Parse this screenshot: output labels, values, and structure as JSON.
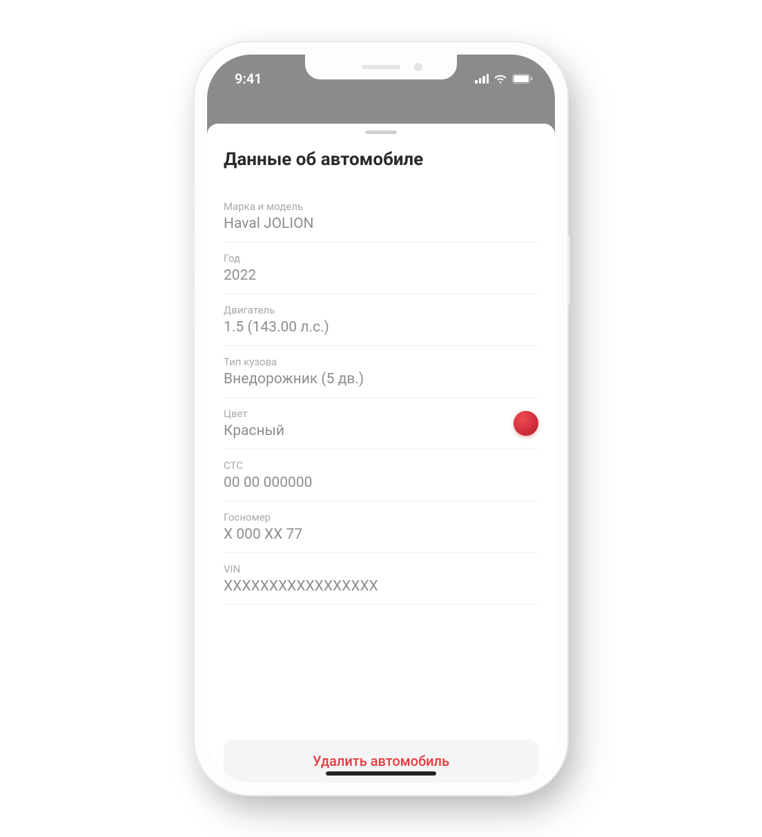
{
  "status": {
    "time": "9:41"
  },
  "page": {
    "title": "Данные об автомобиле"
  },
  "fields": {
    "make_model": {
      "label": "Марка и модель",
      "value": "Haval JOLION"
    },
    "year": {
      "label": "Год",
      "value": "2022"
    },
    "engine": {
      "label": "Двигатель",
      "value": "1.5 (143.00 л.с.)"
    },
    "body": {
      "label": "Тип кузова",
      "value": "Внедорожник (5 дв.)"
    },
    "color": {
      "label": "Цвет",
      "value": "Красный",
      "swatch": "#d7323a"
    },
    "sts": {
      "label": "СТС",
      "value": "00 00 000000"
    },
    "plate": {
      "label": "Госномер",
      "value": "X 000 XX 77"
    },
    "vin": {
      "label": "VIN",
      "value": "XXXXXXXXXXXXXXXXX"
    }
  },
  "actions": {
    "delete_label": "Удалить автомобиль"
  }
}
